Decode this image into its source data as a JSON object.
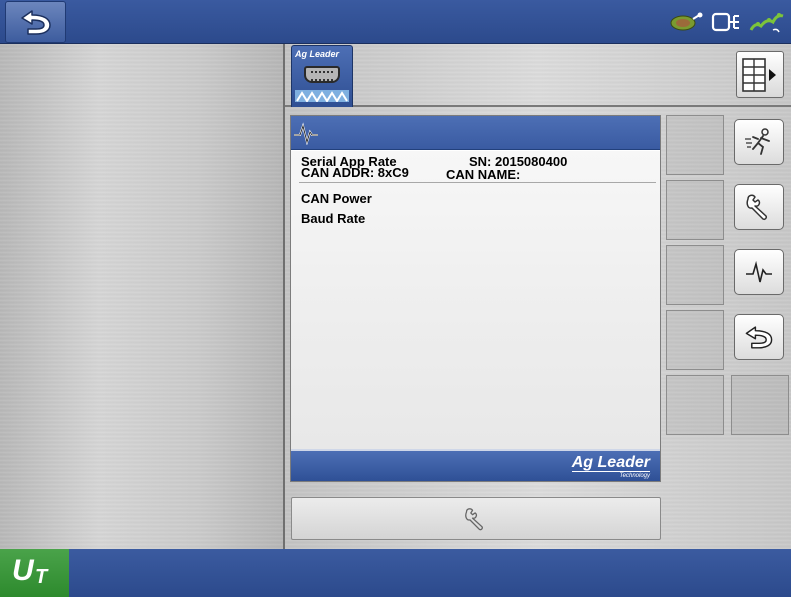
{
  "topbar": {
    "back_icon": "back-arrow-icon",
    "status_icons": [
      "gps-satellite-icon",
      "isobus-connection-icon",
      "wireless-signal-icon"
    ]
  },
  "device_tab": {
    "brand": "Ag Leader",
    "icon": "serial-connector-icon"
  },
  "device_info": {
    "header_icon": "diagnostics-waveform-icon",
    "name": "Serial App Rate",
    "serial_number": "SN: 2015080400",
    "can_address": "CAN ADDR: 8xC9",
    "can_name": "CAN NAME:",
    "items": [
      "CAN Power",
      "Baud Rate"
    ],
    "footer_logo": "Ag Leader",
    "footer_logo_sub": "Technology"
  },
  "side_buttons": [
    {
      "name": "run-button",
      "icon": "running-person-icon"
    },
    {
      "name": "settings-button",
      "icon": "wrench-icon"
    },
    {
      "name": "diagnostics-button",
      "icon": "waveform-icon"
    },
    {
      "name": "back-button",
      "icon": "back-arrow-icon"
    }
  ],
  "settings_bar": {
    "icon": "wrench-icon"
  },
  "bottombar": {
    "ut_letter_u": "U",
    "ut_letter_t": "T"
  },
  "colors": {
    "bar_blue": "#2c4a8c",
    "header_blue": "#4d6fb5",
    "ut_green": "#3b9b3b"
  }
}
